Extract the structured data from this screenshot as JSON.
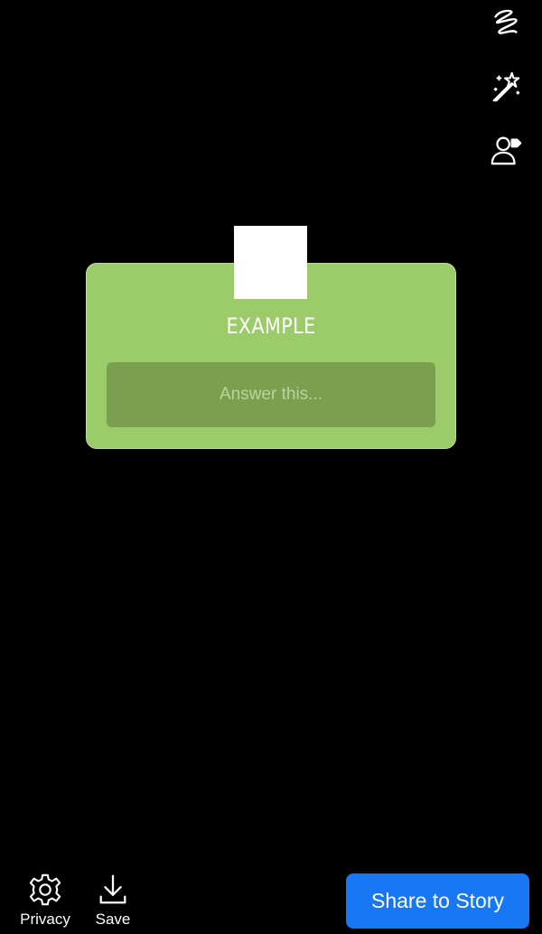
{
  "tools": [
    {
      "name": "draw",
      "icon": "squiggle-draw-icon"
    },
    {
      "name": "effects",
      "icon": "magic-wand-icon"
    },
    {
      "name": "tag-people",
      "icon": "tag-person-icon"
    }
  ],
  "sticker": {
    "title": "EXAMPLE",
    "answer_placeholder": "Answer this...",
    "background_color": "#9ccb69",
    "answer_box_color": "#7a9f4e"
  },
  "bottom_bar": {
    "privacy_label": "Privacy",
    "save_label": "Save",
    "share_label": "Share to Story",
    "share_color": "#1877f2"
  }
}
